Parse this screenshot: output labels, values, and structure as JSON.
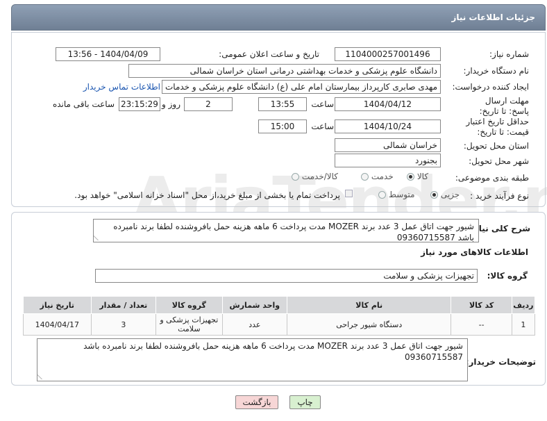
{
  "header": {
    "title": "جزئیات اطلاعات نیاز"
  },
  "form": {
    "need_number": {
      "label": "شماره نیاز:",
      "value": "1104000257001496"
    },
    "announce_datetime": {
      "label": "تاریخ و ساعت اعلان عمومی:",
      "value": "1404/04/09 - 13:56"
    },
    "buyer_org": {
      "label": "نام دستگاه خریدار:",
      "value": "دانشگاه علوم پزشکی و خدمات بهداشتی درمانی استان خراسان شمالی"
    },
    "requester": {
      "label": "ایجاد کننده درخواست:",
      "value": "مهدی صابری کارپرداز بیمارستان امام علی (ع) دانشگاه علوم پزشکی و خدمات ب",
      "contact_link": "اطلاعات تماس خریدار"
    },
    "deadline": {
      "label": "مهلت ارسال پاسخ: تا تاریخ:",
      "date": "1404/04/12",
      "time_label": "ساعت",
      "time": "13:55",
      "days": "2",
      "days_label": "روز و",
      "remaining": "23:15:29",
      "remaining_label": "ساعت باقی مانده"
    },
    "price_validity": {
      "label": "حداقل تاریخ اعتبار قیمت: تا تاریخ:",
      "date": "1404/10/24",
      "time_label": "ساعت",
      "time": "15:00"
    },
    "delivery_province": {
      "label": "استان محل تحویل:",
      "value": "خراسان شمالی"
    },
    "delivery_city": {
      "label": "شهر محل تحویل:",
      "value": "بجنورد"
    },
    "category": {
      "label": "طبقه بندی موضوعی:",
      "options": [
        "کالا",
        "خدمت",
        "کالا/خدمت"
      ],
      "selected": "کالا"
    },
    "process_type": {
      "label": "نوع فرآیند خرید :",
      "options": [
        "جزیی",
        "متوسط"
      ],
      "selected": "جزیی",
      "note": "پرداخت تمام یا بخشی از مبلغ خرید،از محل \"اسناد خزانه اسلامی\" خواهد بود."
    }
  },
  "description": {
    "label": "شرح کلی نیاز:",
    "line1": "شیور جهت اتاق عمل 3 عدد برند MOZER  مدت پرداخت 6 ماهه هزینه حمل بافروشنده   لطفا برند نامبرده",
    "line2": "باشد 09360715587"
  },
  "items_section": {
    "title": "اطلاعات کالاهای مورد نیاز",
    "group_label": "گروه کالا:",
    "group_value": "تجهیزات پزشکی و سلامت",
    "columns": [
      "ردیف",
      "کد کالا",
      "نام کالا",
      "واحد شمارش",
      "گروه کالا",
      "تعداد / مقدار",
      "تاریخ نیاز"
    ],
    "rows": [
      {
        "row": "1",
        "code": "--",
        "name": "دستگاه شیور جراحی",
        "unit": "عدد",
        "group": "تجهیزات پزشکی و سلامت",
        "qty": "3",
        "date": "1404/04/17"
      }
    ]
  },
  "buyer_notes": {
    "label": "توضیحات خریدار:",
    "line1": "شیور جهت اتاق عمل 3 عدد برند MOZER  مدت پرداخت 6 ماهه هزینه حمل بافروشنده   لطفا برند نامبرده باشد",
    "line2": "09360715587"
  },
  "buttons": {
    "print": "چاپ",
    "back": "بازگشت"
  },
  "watermark": "AriaTender.neT",
  "colors": {
    "header": "#7b8ba0",
    "link": "#1a55b0",
    "back_button": "#f7d6d6",
    "print_button": "#d8f0d0"
  }
}
